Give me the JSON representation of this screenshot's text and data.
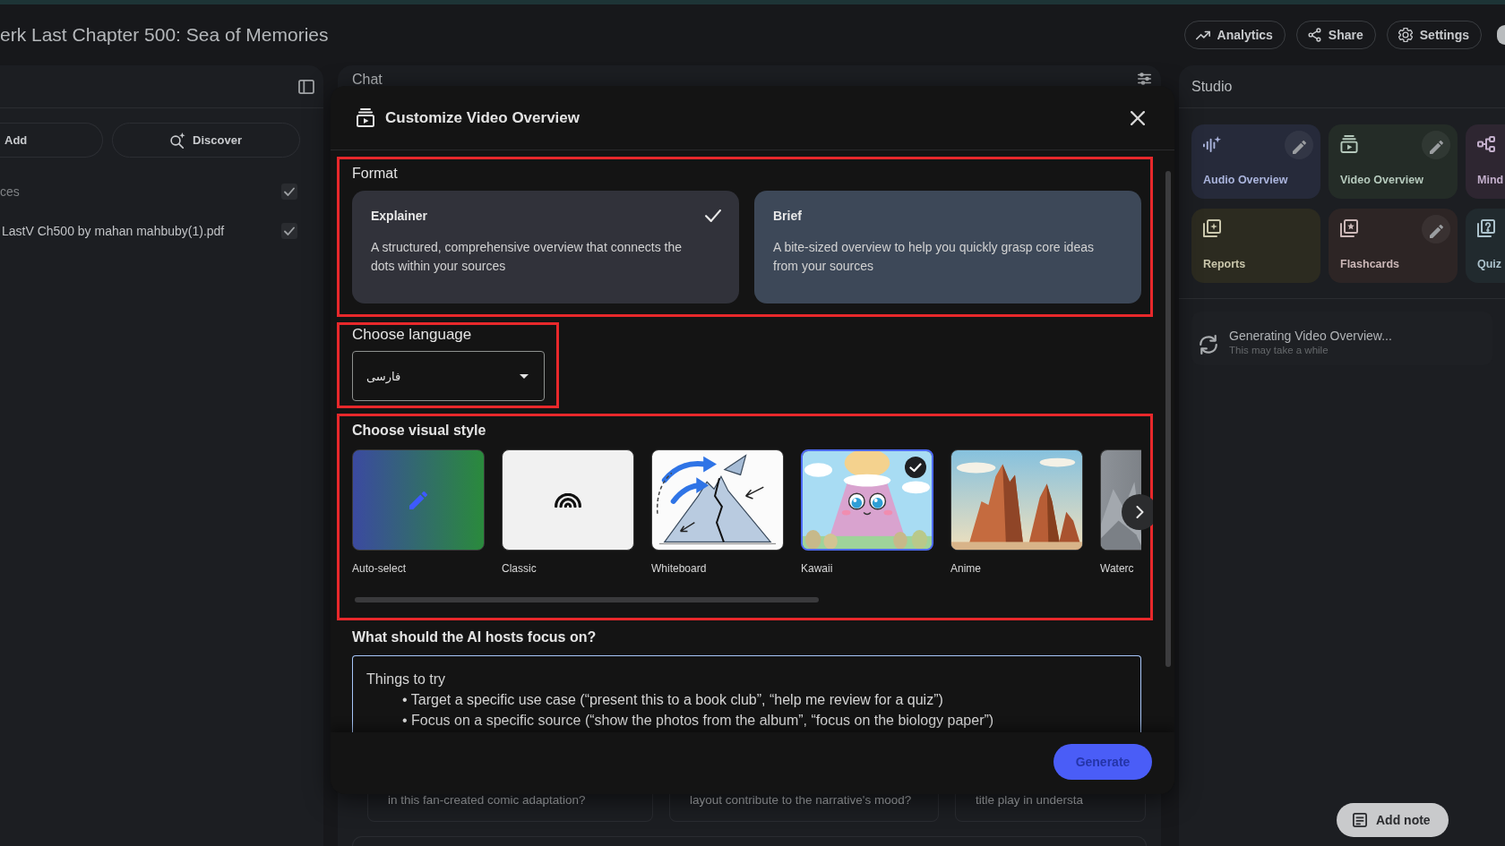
{
  "top_bar": {
    "title": "erk Last Chapter 500: Sea of Memories",
    "actions": [
      "Analytics",
      "Share",
      "Settings"
    ]
  },
  "sources_panel": {
    "add_label": "Add",
    "discover_label": "Discover",
    "select_all": {
      "label": "ces",
      "checked": true
    },
    "sources": [
      {
        "name": "LastV Ch500 by mahan mahbuby(1).pdf",
        "checked": true
      }
    ]
  },
  "chat_panel": {
    "title": "Chat",
    "suggestions": [
      "in this fan-created comic adaptation?",
      "layout contribute to the narrative's mood?",
      "title play in understa"
    ]
  },
  "dialog": {
    "title": "Customize Video Overview",
    "format": {
      "label": "Format",
      "highlighted": true,
      "options": [
        {
          "title": "Explainer",
          "description": "A structured, comprehensive overview that connects the dots within your sources",
          "selected": true
        },
        {
          "title": "Brief",
          "description": "A bite-sized overview to help you quickly grasp core ideas from your sources",
          "selected": false
        }
      ]
    },
    "language": {
      "label": "Choose language",
      "highlighted": true,
      "value": "فارسی"
    },
    "visual_style": {
      "label": "Choose visual style",
      "highlighted": true,
      "styles": [
        {
          "name": "Auto-select",
          "kind": "auto",
          "selected": false
        },
        {
          "name": "Classic",
          "kind": "classic",
          "selected": false
        },
        {
          "name": "Whiteboard",
          "kind": "whiteboard",
          "selected": false
        },
        {
          "name": "Kawaii",
          "kind": "kawaii",
          "selected": true
        },
        {
          "name": "Anime",
          "kind": "anime",
          "selected": false
        },
        {
          "name": "Waterc",
          "kind": "watercolor",
          "selected": false
        }
      ]
    },
    "focus": {
      "label": "What should the AI hosts focus on?",
      "placeholder": {
        "heading": "Things to try",
        "items": [
          "• Target a specific use case (“present this to a book club”, “help me review for a quiz”)",
          "• Focus on a specific source (“show the photos from the album”, “focus on the biology paper”)"
        ]
      }
    },
    "generate_label": "Generate"
  },
  "studio_panel": {
    "title": "Studio",
    "tools": [
      {
        "label": "Audio Overview",
        "color": "#262a3a",
        "editable": true
      },
      {
        "label": "Video Overview",
        "color": "#242c27",
        "editable": true
      },
      {
        "label": "Mind",
        "color": "#2e2631",
        "editable": false
      },
      {
        "label": "Reports",
        "color": "#2c2b20",
        "editable": false
      },
      {
        "label": "Flashcards",
        "color": "#2d2525",
        "editable": true
      },
      {
        "label": "Quiz",
        "color": "#212a2e",
        "editable": false
      }
    ],
    "generating": {
      "title": "Generating Video Overview...",
      "subtitle": "This may take a while"
    },
    "add_note_label": "Add note"
  }
}
